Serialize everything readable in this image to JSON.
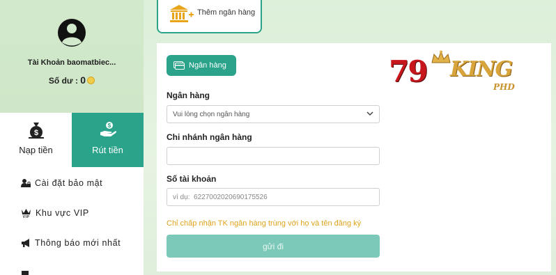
{
  "sidebar": {
    "username": "Tài Khoản baomatbiec...",
    "balance_label": "Số dư : ",
    "balance_value": "0",
    "actions": [
      {
        "label": "Nạp tiền",
        "icon": "money-bag-icon"
      },
      {
        "label": "Rút tiền",
        "icon": "hand-coin-icon"
      }
    ],
    "menu": [
      {
        "label": "Cài đặt bảo mật",
        "icon": "user-lock-icon"
      },
      {
        "label": "Khu vực VIP",
        "icon": "vip-crown-icon"
      },
      {
        "label": "Thông báo mới nhất",
        "icon": "megaphone-icon"
      }
    ]
  },
  "top_tab": {
    "label": "Thêm ngân hàng",
    "icon": "bank-add-icon"
  },
  "form": {
    "section_pill": "Ngân hàng",
    "bank_label": "Ngân hàng",
    "bank_select_value": "Vui lòng chọn ngân hàng",
    "branch_label": "Chi nhánh ngân hàng",
    "branch_value": "",
    "account_label": "Số tài khoản",
    "account_placeholder": "ví dụ:  6227002020690175526",
    "notice": "Chỉ chấp nhận TK ngân hàng trùng với họ và tên đăng ký",
    "submit_label": "gửi đi"
  },
  "logo": {
    "number": "79",
    "word": "KING",
    "suffix": "PHD"
  },
  "colors": {
    "accent": "#2aa38a",
    "submit_disabled": "#7cc9b9",
    "notice": "#e0a31c",
    "logo_red": "#c8161d",
    "logo_gold": "#d8a53c"
  }
}
